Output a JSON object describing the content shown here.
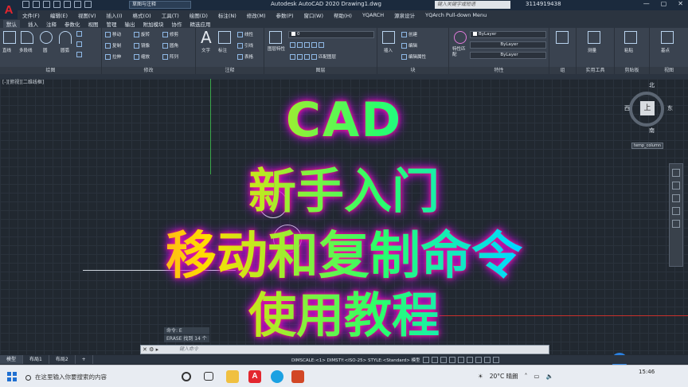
{
  "title_bar": {
    "logo": "A",
    "workspace": "草图与注释",
    "app_title": "Autodesk AutoCAD 2020  Drawing1.dwg",
    "search_placeholder": "键入关键字或短语",
    "user": "3114919438"
  },
  "menu": [
    "文件(F)",
    "编辑(E)",
    "视图(V)",
    "插入(I)",
    "格式(O)",
    "工具(T)",
    "绘图(D)",
    "标注(N)",
    "修改(M)",
    "参数(P)",
    "窗口(W)",
    "帮助(H)",
    "YQARCH",
    "源泉设计",
    "YQArch Pull-down Menu"
  ],
  "ribbon_tabs": [
    "默认",
    "插入",
    "注释",
    "参数化",
    "视图",
    "管理",
    "输出",
    "附加模块",
    "协作",
    "精选应用"
  ],
  "ribbon": {
    "draw_tools": [
      "直线",
      "多段线",
      "圆",
      "圆弧"
    ],
    "draw_label": "绘图",
    "modify_tools": [
      "移动",
      "旋转",
      "修剪",
      "复制",
      "镜像",
      "圆角",
      "拉伸",
      "缩放",
      "阵列"
    ],
    "modify_label": "修改",
    "annot_tools": [
      "文字",
      "标注",
      "线性",
      "引线",
      "表格"
    ],
    "annot_label": "注释",
    "layer_props": "图层特性",
    "layer_current": "0",
    "layer_match": "匹配图层",
    "layer_label": "图层",
    "block_tools": [
      "插入",
      "创建",
      "编辑",
      "编辑属性"
    ],
    "block_label": "块",
    "prop_tools": [
      "特性匹配"
    ],
    "bylayer": [
      "ByLayer",
      "ByLayer",
      "ByLayer"
    ],
    "prop_label": "特性",
    "group_label": "组",
    "util_label": "实用工具",
    "clip_label": "剪贴板",
    "view_label": "视图",
    "measure": "测量",
    "paste": "粘贴",
    "base": "基点"
  },
  "viewport_label": "[-][俯视][二维线框]",
  "viewcube": {
    "face": "上",
    "north": "北",
    "south": "南",
    "east": "东",
    "west": "西",
    "wcs": "temp_column"
  },
  "overlay_title": [
    "CAD",
    "新手入门",
    "移动和复制命令",
    "使用教程"
  ],
  "command": {
    "history": [
      "命令: E",
      "ERASE 找到 14 个"
    ],
    "placeholder": "键入命令"
  },
  "layout_tabs": [
    "模型",
    "布局1",
    "布局2"
  ],
  "status": "DIMSCALE:<1> DIMSTY:<ISO-25> STYLE:<Standard>  模型",
  "taskbar": {
    "search": "在这里输入你要搜索的内容",
    "weather": "20°C 晴朗",
    "time": "15:46"
  },
  "colors": {
    "accent_red": "#e3262e",
    "ribbon_bg": "#3a4350",
    "canvas_bg": "#212830"
  }
}
